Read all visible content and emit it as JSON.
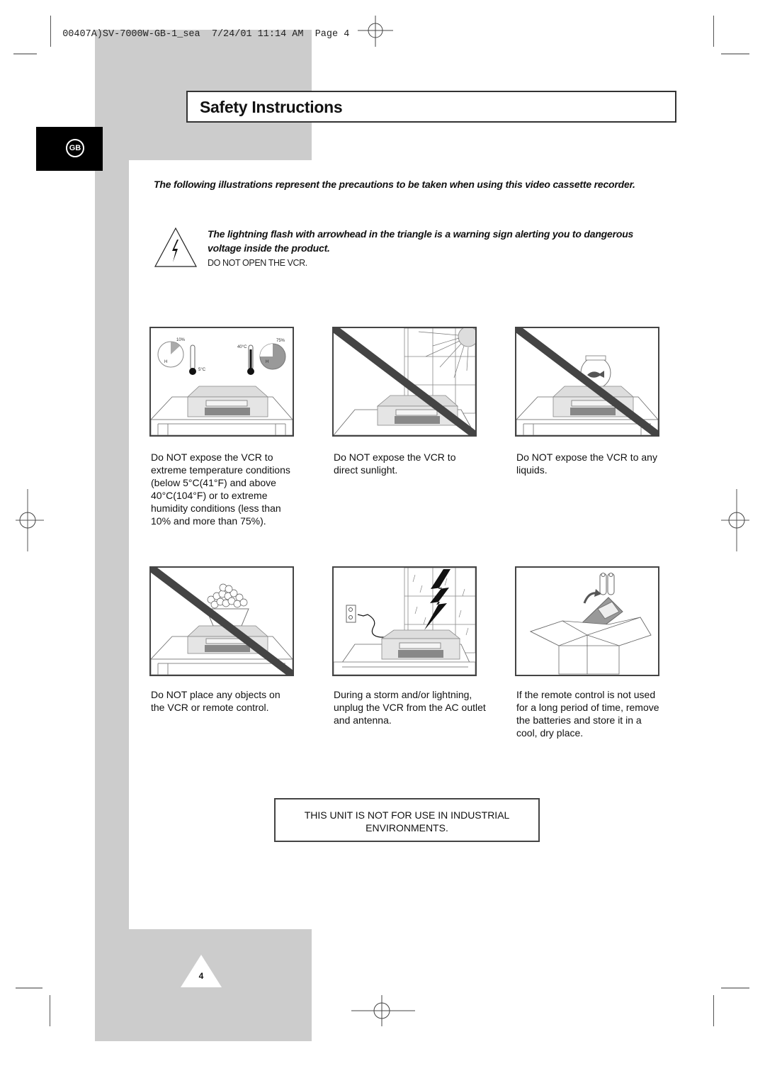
{
  "header": {
    "slug": "00407A)SV-7000W-GB-1_sea",
    "date": "7/24/01",
    "time": "11:14 AM",
    "page_label": "Page 4"
  },
  "title": "Safety Instructions",
  "language_badge": "GB",
  "intro": "The following illustrations represent the precautions to be taken when using this video cassette recorder.",
  "warning": {
    "icon": "lightning-triangle-icon",
    "text": "The lightning flash with arrowhead in the triangle is a warning sign alerting you to dangerous voltage inside the product.",
    "instruction": "DO NOT OPEN THE VCR."
  },
  "illustrations": [
    {
      "id": "temperature",
      "labels": {
        "humidity_low": "10%",
        "humidity_high": "75%",
        "temp_low": "5°C",
        "temp_high": "40°C",
        "h": "H"
      },
      "caption": "Do NOT expose the VCR to extreme temperature conditions (below 5°C(41°F) and above 40°C(104°F) or to extreme humidity conditions (less than 10% and more than 75%)."
    },
    {
      "id": "sunlight",
      "caption": "Do NOT expose the VCR to direct sunlight."
    },
    {
      "id": "liquids",
      "caption": "Do NOT expose the VCR to any liquids."
    },
    {
      "id": "objects",
      "caption": "Do NOT place any objects on the VCR or remote control."
    },
    {
      "id": "storm",
      "caption": "During a storm and/or lightning, unplug the VCR from the AC outlet and antenna."
    },
    {
      "id": "remote",
      "caption": "If the remote control is not used for a long period of time, remove the batteries and store it in a cool, dry place."
    }
  ],
  "notice": "THIS UNIT IS NOT FOR USE IN INDUSTRIAL ENVIRONMENTS.",
  "page_number": "4",
  "colors": {
    "panel_gray": "#cccccc",
    "prohibit_bar": "#444444",
    "badge_black": "#000000"
  }
}
